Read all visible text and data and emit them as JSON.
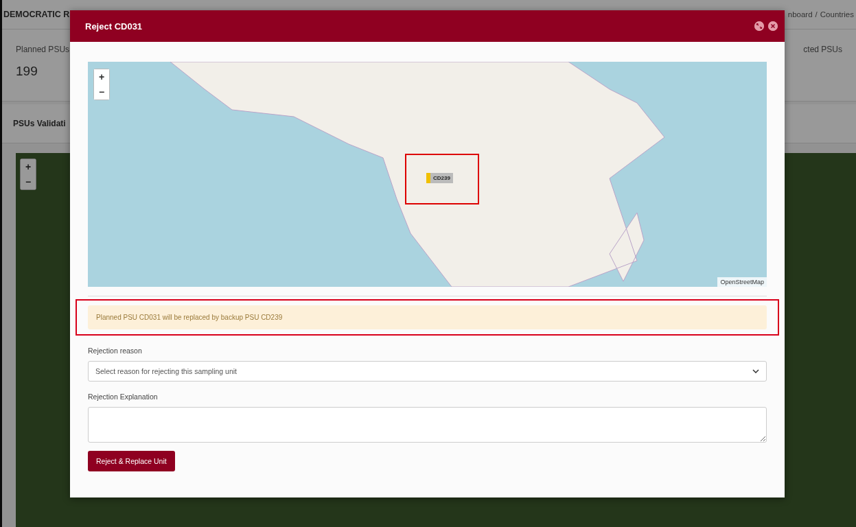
{
  "page": {
    "title": "DEMOCRATIC R",
    "breadcrumb": {
      "items": [
        "nboard",
        "Countries"
      ],
      "separator": "/"
    },
    "stats": [
      {
        "label": "Planned PSUs",
        "value": "199"
      },
      {
        "label": "cted PSUs"
      }
    ],
    "section_title": "PSUs Validati",
    "map": {
      "zoom_in": "+",
      "zoom_out": "−"
    }
  },
  "modal": {
    "title": "Reject CD031",
    "map": {
      "zoom_in": "+",
      "zoom_out": "−",
      "marker": "CD239",
      "attribution": "OpenStreetMap"
    },
    "alert": "Planned PSU CD031 will be replaced by backup PSU CD239",
    "fields": [
      {
        "kind": "select",
        "label": "Rejection reason",
        "placeholder": "Select reason for rejecting this sampling unit"
      },
      {
        "kind": "textarea",
        "label": "Rejection Explanation"
      }
    ],
    "submit": "Reject & Replace Unit"
  }
}
